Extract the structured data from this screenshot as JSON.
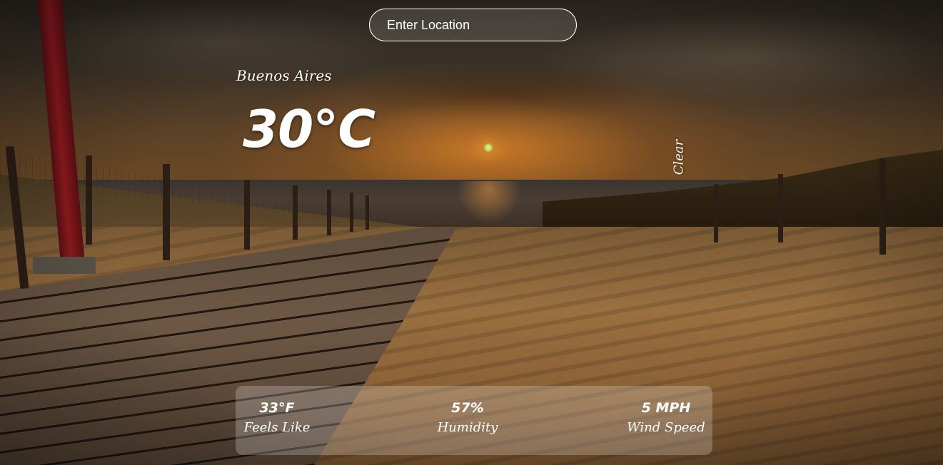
{
  "search": {
    "placeholder": "Enter Location"
  },
  "weather": {
    "city": "Buenos Aires",
    "temperature": "30°C",
    "condition": "Clear"
  },
  "stats": {
    "feels_like": {
      "value": "33°F",
      "label": "Feels Like"
    },
    "humidity": {
      "value": "57%",
      "label": "Humidity"
    },
    "wind_speed": {
      "value": "5 MPH",
      "label": "Wind Speed"
    }
  },
  "icons": [
    "search-input-field"
  ],
  "colors": {
    "text": "#ffffff",
    "panel": "rgba(255,255,255,0.22)"
  }
}
